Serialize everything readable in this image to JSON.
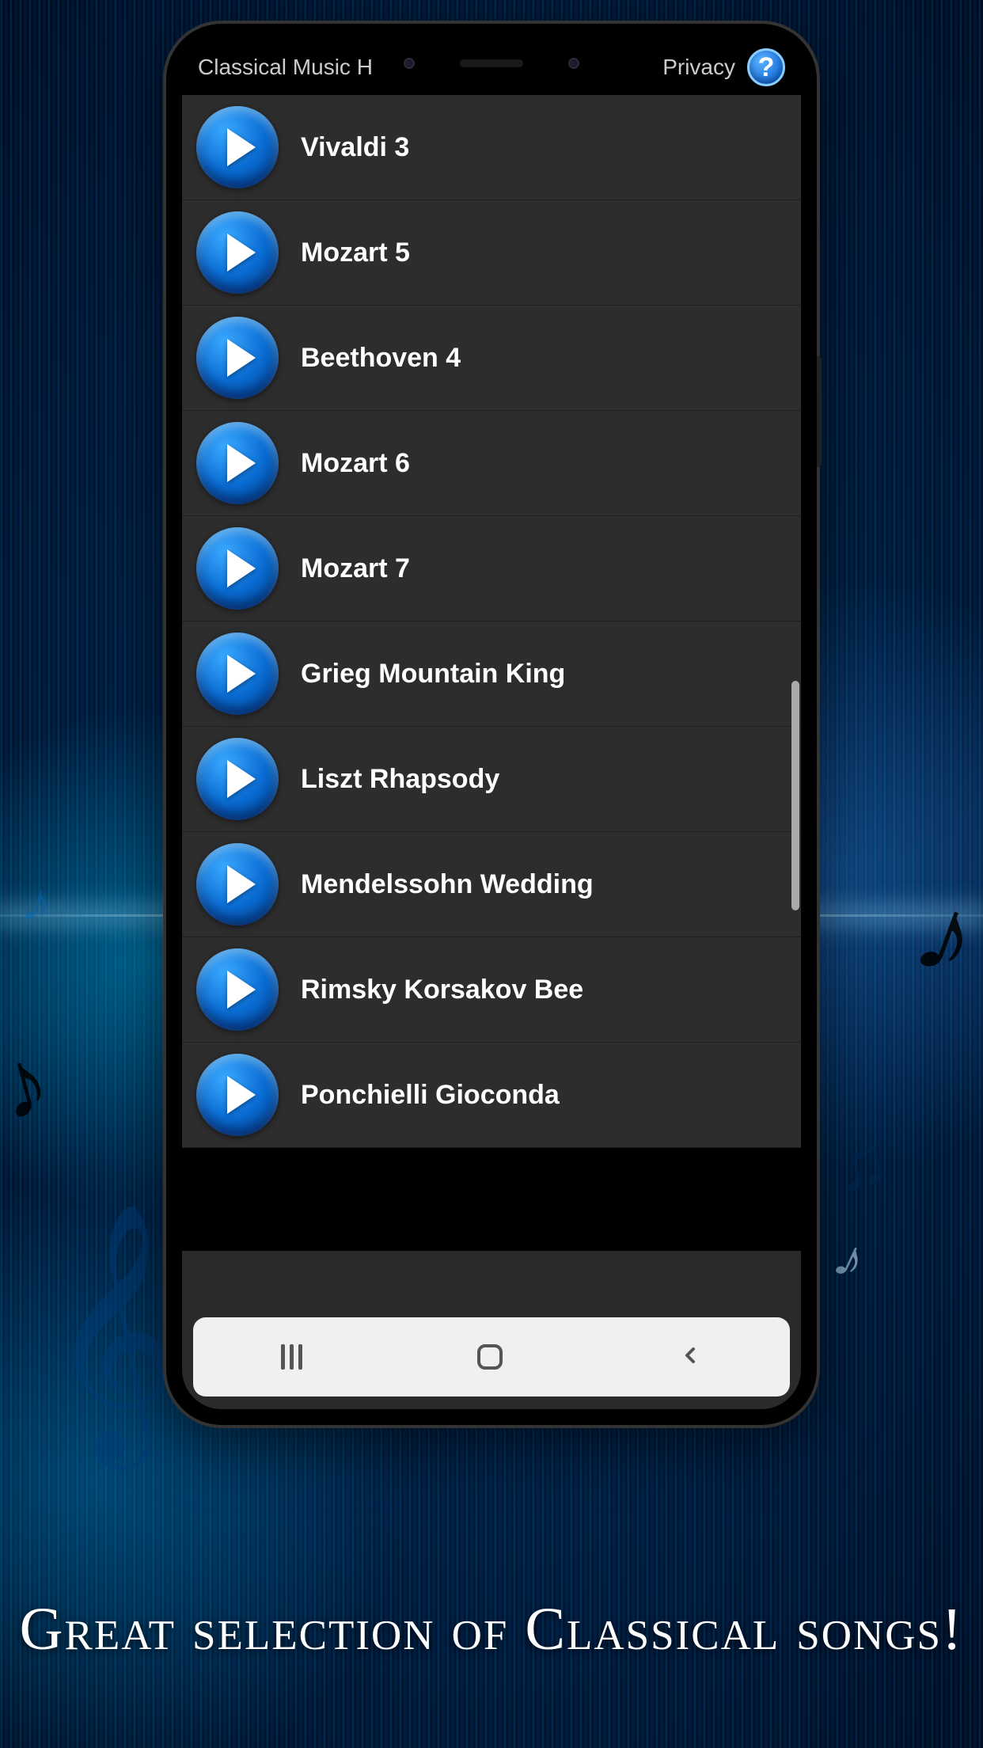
{
  "header": {
    "title": "Classical Music H",
    "privacy": "Privacy",
    "help_symbol": "?"
  },
  "songs": [
    {
      "title": "Vivaldi 3"
    },
    {
      "title": "Mozart 5"
    },
    {
      "title": "Beethoven 4"
    },
    {
      "title": "Mozart 6"
    },
    {
      "title": "Mozart 7"
    },
    {
      "title": "Grieg Mountain King"
    },
    {
      "title": "Liszt Rhapsody"
    },
    {
      "title": "Mendelssohn Wedding"
    },
    {
      "title": "Rimsky Korsakov Bee"
    },
    {
      "title": "Ponchielli Gioconda"
    }
  ],
  "caption": "Great selection of Classical songs!"
}
